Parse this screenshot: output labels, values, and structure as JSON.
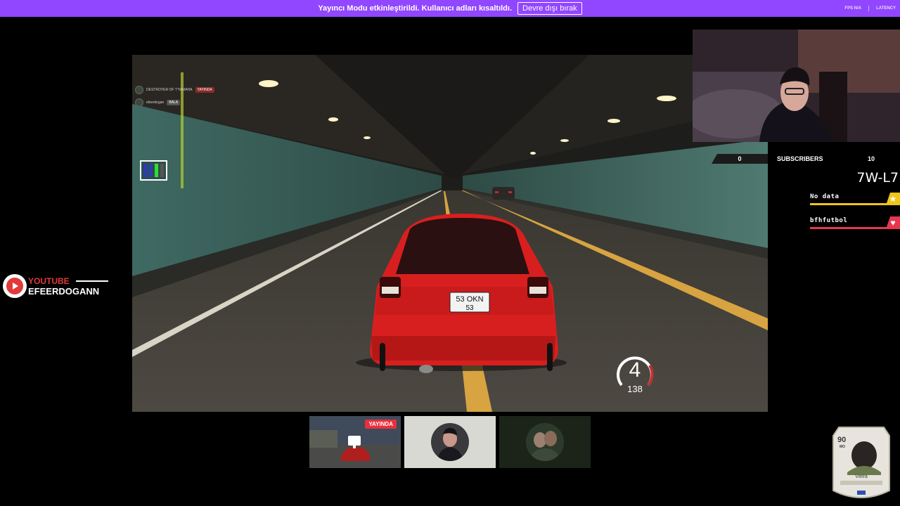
{
  "banner": {
    "message": "Yayıncı Modu etkinleştirildi. Kullanıcı adları kısaltıldı.",
    "button_label": "Devre dışı bırak",
    "fps_label": "FPS",
    "fps_value": "N/A",
    "latency_label": "LATENCY"
  },
  "game": {
    "plate_top": "53 OKN",
    "plate_bottom": "53",
    "gear": "4",
    "speed": "138",
    "chat": [
      {
        "user": "DESTROYER OF T'YAMAHA",
        "tag": "YAYINDA"
      },
      {
        "user": "efeerdogan",
        "tag": "BALA"
      }
    ]
  },
  "widgets": {
    "subscriber_pill": "0",
    "subscriber_label": "SUBSCRIBERS",
    "subscriber_count": "10",
    "code": "7W-L7",
    "alerts": [
      {
        "text": "No data",
        "color": "#f0c419",
        "icon": "star-icon"
      },
      {
        "text": "bfhfutbol",
        "color": "#e8364f",
        "icon": "heart-icon"
      }
    ]
  },
  "youtube": {
    "label": "YOUTUBE",
    "channel": "EFEERDOGANN"
  },
  "thumbnails": [
    {
      "badge": "YAYINDA"
    }
  ],
  "card": {
    "rating": "90",
    "position": "MO",
    "name": "Vieira"
  },
  "colors": {
    "banner": "#9146ff",
    "live": "#e8303c",
    "youtube_red": "#e03a3a"
  }
}
